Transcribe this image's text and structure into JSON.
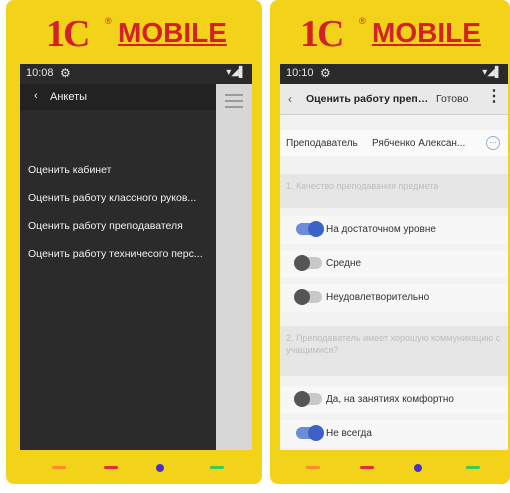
{
  "left": {
    "logo": {
      "mark": "1С",
      "text": "MOBILE"
    },
    "status": {
      "time": "10:08",
      "gear": "⚙",
      "icons": "▾◢▌"
    },
    "header": {
      "back": "‹",
      "title": "Анкеты"
    },
    "items": [
      "Оценить кабинет",
      "Оценить работу классного руков...",
      "Оценить работу преподавателя",
      "Оценить работу техничесого перс..."
    ]
  },
  "right": {
    "logo": {
      "mark": "1С",
      "text": "MOBILE"
    },
    "status": {
      "time": "10:10",
      "gear": "⚙",
      "icons": "▾◢▌"
    },
    "header": {
      "back": "‹",
      "title": "Оценить работу препод...",
      "done": "Готово",
      "more": "⋮"
    },
    "teacher": {
      "label": "Преподаватель",
      "value": "Рябченко Алексан..."
    },
    "question1": "1. Качество преподавания предмета",
    "options1": [
      {
        "label": "На достаточном уровне",
        "on": true
      },
      {
        "label": "Средне",
        "on": false
      },
      {
        "label": "Неудовлетворительно",
        "on": false
      }
    ],
    "question2": "2. Преподаватель имеет хорошую коммуникацию с учащимися?",
    "options2": [
      {
        "label": "Да, на занятиях комфортно",
        "on": false
      },
      {
        "label": "Не всегда",
        "on": true
      }
    ]
  },
  "colors": {
    "accent": "#3a62c7",
    "brand": "#d32127",
    "frame": "#f3d21a"
  }
}
